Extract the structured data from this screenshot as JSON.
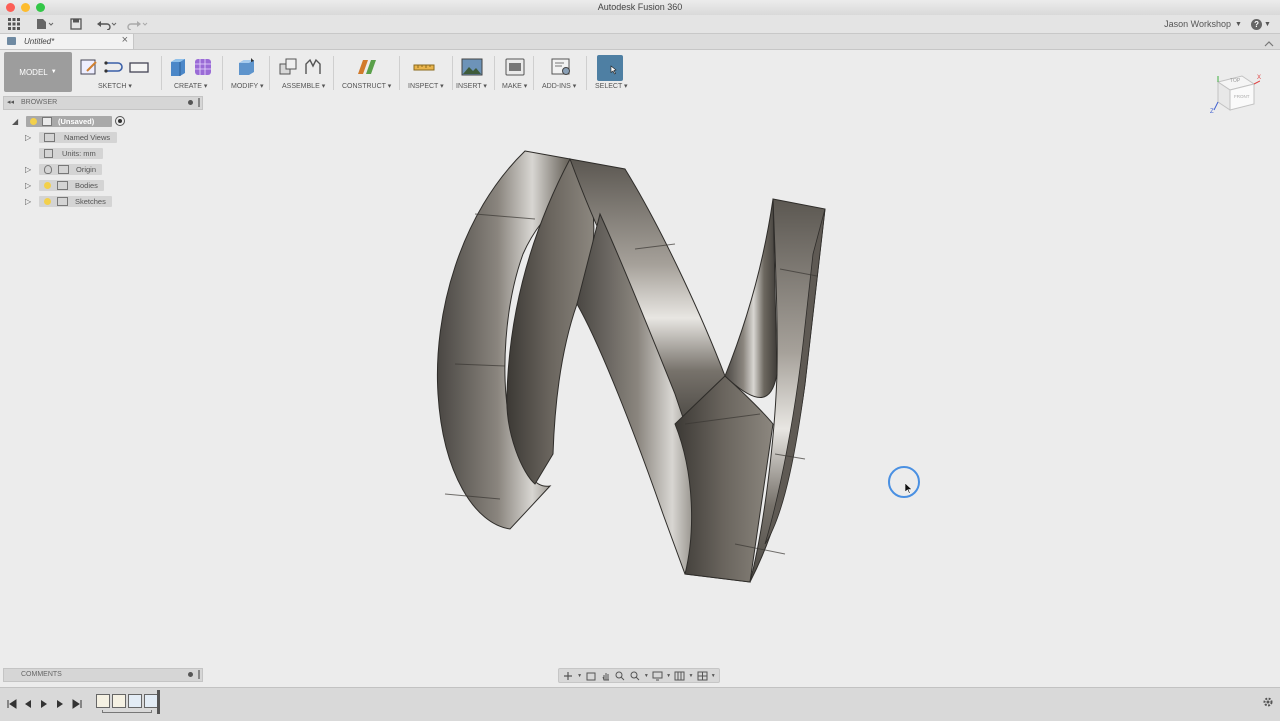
{
  "window": {
    "title": "Autodesk Fusion 360"
  },
  "appbar": {
    "user": "Jason Workshop",
    "help": "?"
  },
  "tab": {
    "title": "Untitled*",
    "close": "×"
  },
  "toolbar": {
    "workspace": "MODEL",
    "groups": [
      {
        "label": "SKETCH"
      },
      {
        "label": "CREATE"
      },
      {
        "label": "MODIFY"
      },
      {
        "label": "ASSEMBLE"
      },
      {
        "label": "CONSTRUCT"
      },
      {
        "label": "INSPECT"
      },
      {
        "label": "INSERT"
      },
      {
        "label": "MAKE"
      },
      {
        "label": "ADD-INS"
      },
      {
        "label": "SELECT"
      }
    ]
  },
  "browser": {
    "title": "BROWSER",
    "root": "(Unsaved)",
    "items": [
      {
        "label": "Named Views"
      },
      {
        "label": "Units: mm"
      },
      {
        "label": "Origin"
      },
      {
        "label": "Bodies"
      },
      {
        "label": "Sketches"
      }
    ]
  },
  "viewcube": {
    "top": "TOP",
    "front": "FRONT",
    "x": "X",
    "z": "Z"
  },
  "comments": {
    "title": "COMMENTS"
  },
  "colors": {
    "accent": "#4a90e2",
    "select_active": "#4e7fa3",
    "body_steel": "#6f6a63"
  }
}
